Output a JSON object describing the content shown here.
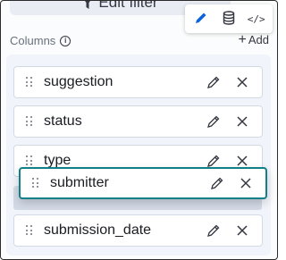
{
  "header": {
    "edit_filter_label": "Edit filter"
  },
  "toolbar": {
    "buttons": [
      {
        "icon": "pencil-icon",
        "active": true
      },
      {
        "icon": "database-icon",
        "active": false
      },
      {
        "icon": "code-icon",
        "label": "</>",
        "active": false
      }
    ]
  },
  "columns": {
    "label": "Columns",
    "add_label": "Add",
    "items": [
      {
        "name": "suggestion"
      },
      {
        "name": "status"
      },
      {
        "name": "type"
      },
      {
        "name": "submitter",
        "state": "dragging"
      },
      {
        "name": "submission_date"
      }
    ]
  },
  "colors": {
    "accent": "#0b64dd",
    "drag_border": "#0f8087",
    "panel_bg": "#f1f4fa"
  }
}
